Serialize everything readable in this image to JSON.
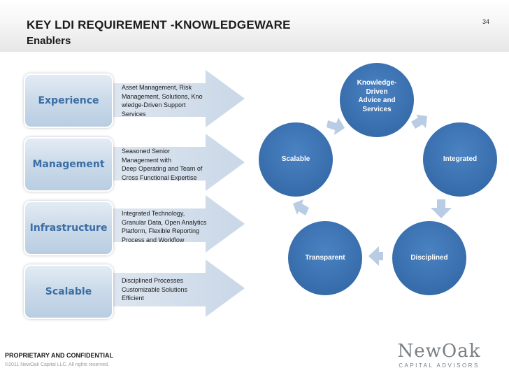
{
  "header": {
    "title": "KEY LDI REQUIREMENT -KNOWLEDGEWARE",
    "subtitle": "Enablers",
    "page_number": "34"
  },
  "enablers": [
    {
      "label": "Experience",
      "lines": [
        "Asset  Management, Risk",
        "Management, Solutions, Kno",
        "wledge-Driven Support",
        "Services"
      ]
    },
    {
      "label": "Management",
      "lines": [
        "Seasoned Senior",
        "Management with",
        "Deep Operating  and Team of",
        "Cross Functional Expertise"
      ]
    },
    {
      "label": "Infrastructure",
      "lines": [
        "Integrated Technology,",
        "Granular Data, Open Analytics",
        "Platform, Flexible Reporting",
        "Process and Workflow"
      ]
    },
    {
      "label": "Scalable",
      "lines": [
        "Disciplined Processes",
        "Customizable Solutions",
        "Efficient"
      ]
    }
  ],
  "cycle": {
    "nodes": [
      {
        "label_lines": [
          "Knowledge-",
          "Driven",
          "Advice and",
          "Services"
        ]
      },
      {
        "label_lines": [
          "Integrated"
        ]
      },
      {
        "label_lines": [
          "Disciplined"
        ]
      },
      {
        "label_lines": [
          "Transparent"
        ]
      },
      {
        "label_lines": [
          "Scalable"
        ]
      }
    ],
    "node_color": "#3d72b0",
    "arrow_color": "#b8cce4"
  },
  "footer": {
    "confidential": "PROPRIETARY AND CONFIDENTIAL",
    "copyright": "©2011 NewOak Capital LLC. All rights reserved.",
    "logo_name": "NewOak",
    "logo_sub": "CAPITAL ADVISORS"
  }
}
